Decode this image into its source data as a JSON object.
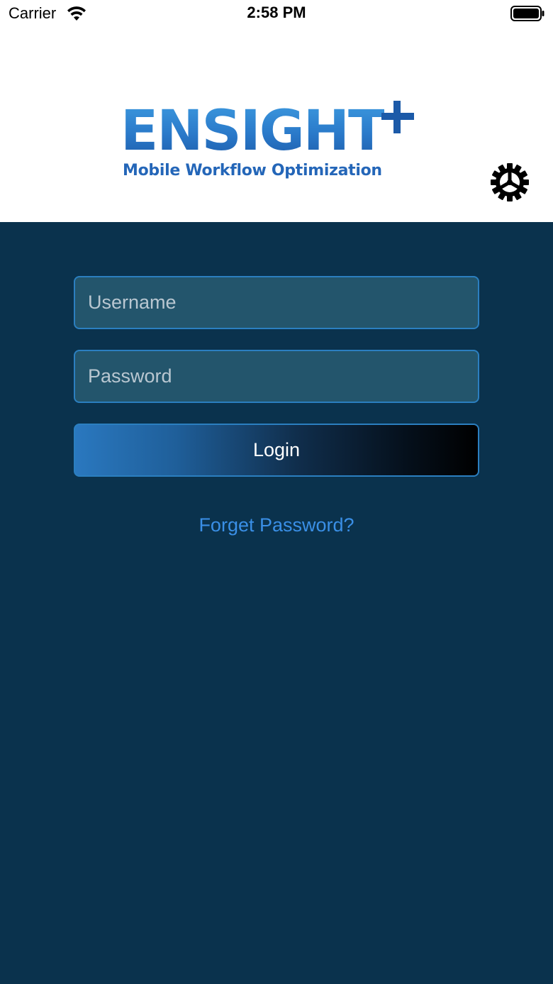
{
  "status_bar": {
    "carrier": "Carrier",
    "time": "2:58 PM",
    "wifi_icon": "wifi-icon",
    "battery_icon": "battery-full-icon"
  },
  "header": {
    "logo_word": "ENSIGHT",
    "logo_tagline": "Mobile Workflow Optimization",
    "logo_plus_icon": "plus-icon",
    "settings_icon": "gear-icon"
  },
  "login": {
    "username_placeholder": "Username",
    "username_value": "",
    "password_placeholder": "Password",
    "password_value": "",
    "login_label": "Login",
    "forgot_label": "Forget Password?"
  },
  "colors": {
    "panel_background": "#0a324d",
    "field_background": "#23556c",
    "field_border": "#2b7fc0",
    "link": "#3a8fe6",
    "brand_blue": "#2466b8"
  }
}
